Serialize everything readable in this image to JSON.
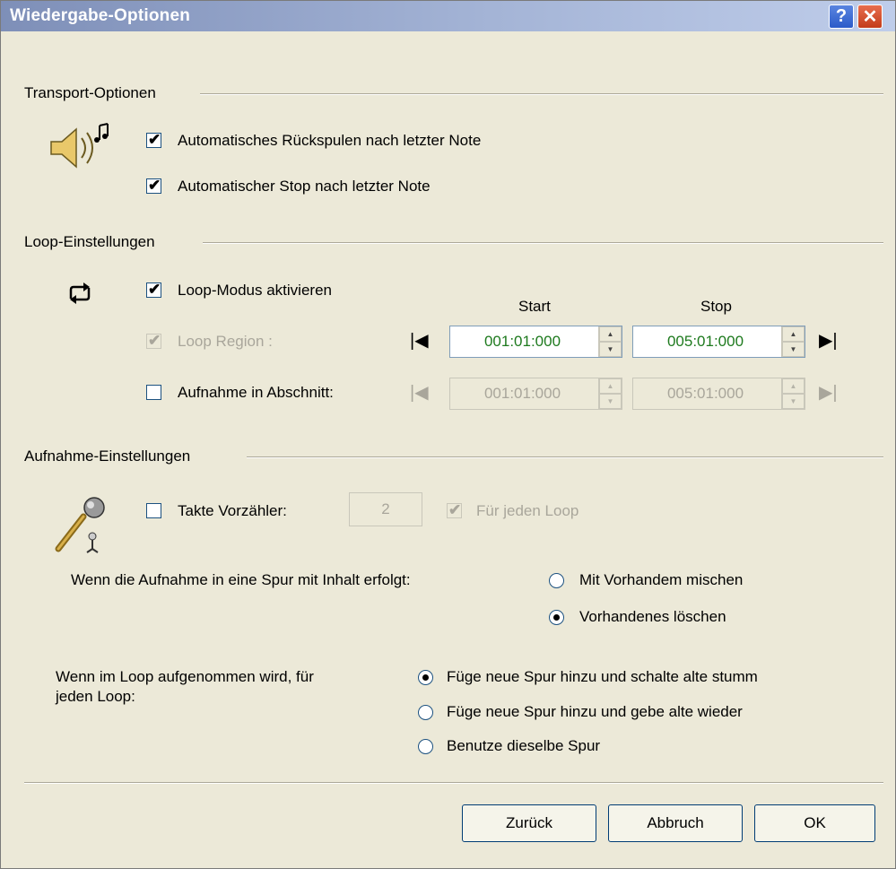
{
  "window": {
    "title": "Wiedergabe-Optionen",
    "help_label": "?",
    "close_label": "✕"
  },
  "transport": {
    "section_label": "Transport-Optionen",
    "auto_rewind": {
      "label": "Automatisches Rückspulen nach letzter Note",
      "checked": true
    },
    "auto_stop": {
      "label": "Automatischer Stop nach letzter Note",
      "checked": true
    }
  },
  "loop": {
    "section_label": "Loop-Einstellungen",
    "loop_mode": {
      "label": "Loop-Modus aktivieren",
      "checked": true
    },
    "start_header": "Start",
    "stop_header": "Stop",
    "loop_region": {
      "label": "Loop Region :",
      "checked": true,
      "start": "001:01:000",
      "stop": "005:01:000"
    },
    "record_section": {
      "label": "Aufnahme in Abschnitt:",
      "checked": false,
      "start": "001:01:000",
      "stop": "005:01:000"
    }
  },
  "recording": {
    "section_label": "Aufnahme-Einstellungen",
    "count_in": {
      "label": "Takte Vorzähler:",
      "checked": false,
      "value": "2"
    },
    "each_loop": {
      "label": "Für jeden Loop",
      "checked": true
    },
    "content_question": "Wenn die Aufnahme in eine Spur mit Inhalt erfolgt:",
    "content_options": [
      {
        "label": "Mit Vorhandem mischen",
        "selected": false
      },
      {
        "label": "Vorhandenes löschen",
        "selected": true
      }
    ],
    "loop_question_line1": "Wenn im Loop aufgenommen wird, für",
    "loop_question_line2": "jeden Loop:",
    "loop_options": [
      {
        "label": "Füge neue Spur hinzu und schalte alte stumm",
        "selected": true
      },
      {
        "label": "Füge neue Spur hinzu und gebe alte wieder",
        "selected": false
      },
      {
        "label": "Benutze dieselbe Spur",
        "selected": false
      }
    ]
  },
  "buttons": {
    "back": "Zurück",
    "cancel": "Abbruch",
    "ok": "OK"
  },
  "colors": {
    "dialog_bg": "#ECE9D8",
    "time_value": "#1e7a1e",
    "disabled_text": "#a9a69b"
  }
}
